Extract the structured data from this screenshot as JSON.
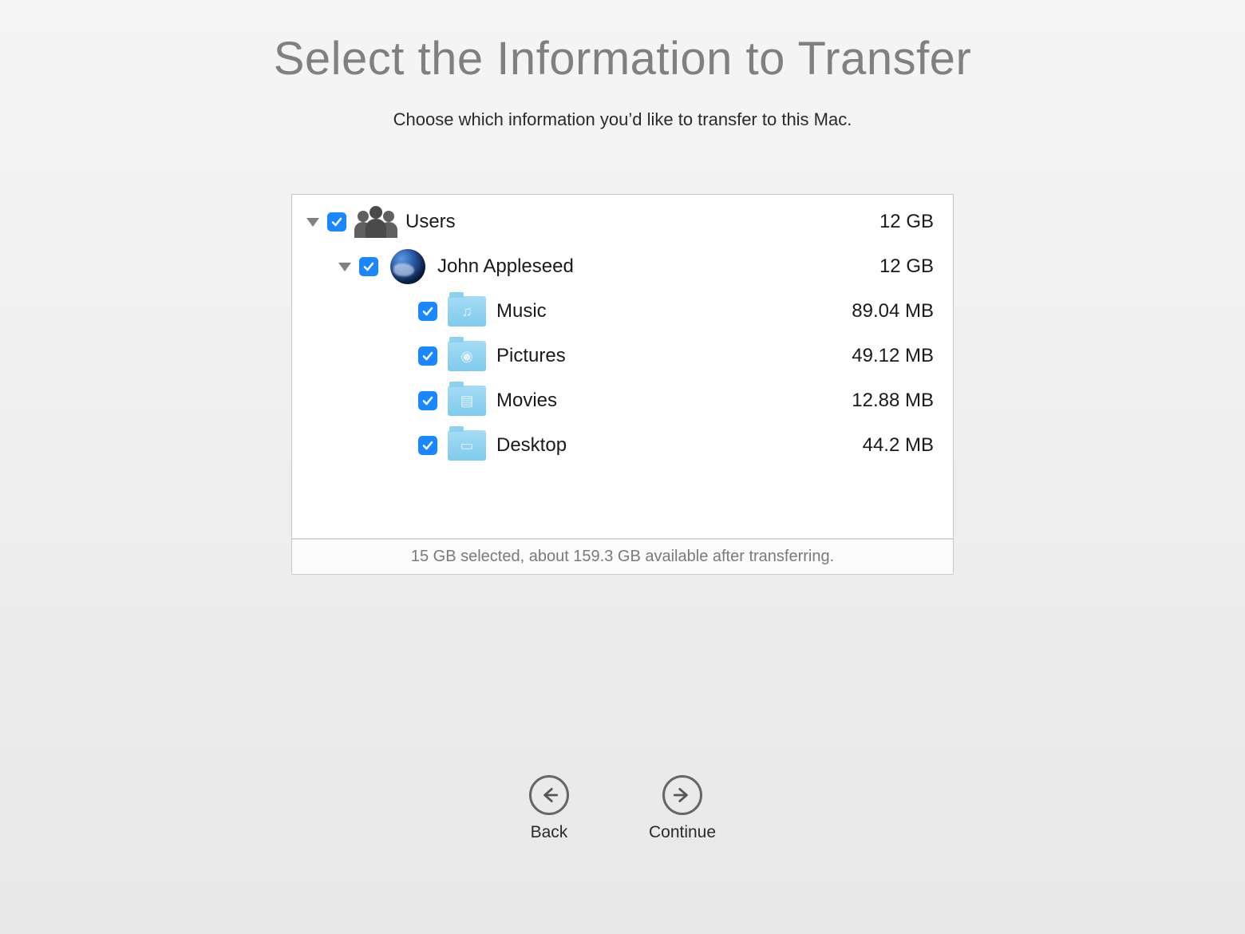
{
  "title": "Select the Information to Transfer",
  "subtitle": "Choose which information you’d like to transfer to this Mac.",
  "tree": {
    "users": {
      "label": "Users",
      "size": "12 GB"
    },
    "user": {
      "label": "John Appleseed",
      "size": "12 GB"
    },
    "items": [
      {
        "label": "Music",
        "size": "89.04 MB",
        "glyph": "♫"
      },
      {
        "label": "Pictures",
        "size": "49.12 MB",
        "glyph": "◉"
      },
      {
        "label": "Movies",
        "size": "12.88 MB",
        "glyph": "▤"
      },
      {
        "label": "Desktop",
        "size": "44.2 MB",
        "glyph": "▭"
      }
    ]
  },
  "status": "15 GB selected, about 159.3 GB available after transferring.",
  "buttons": {
    "back": "Back",
    "continue": "Continue"
  }
}
